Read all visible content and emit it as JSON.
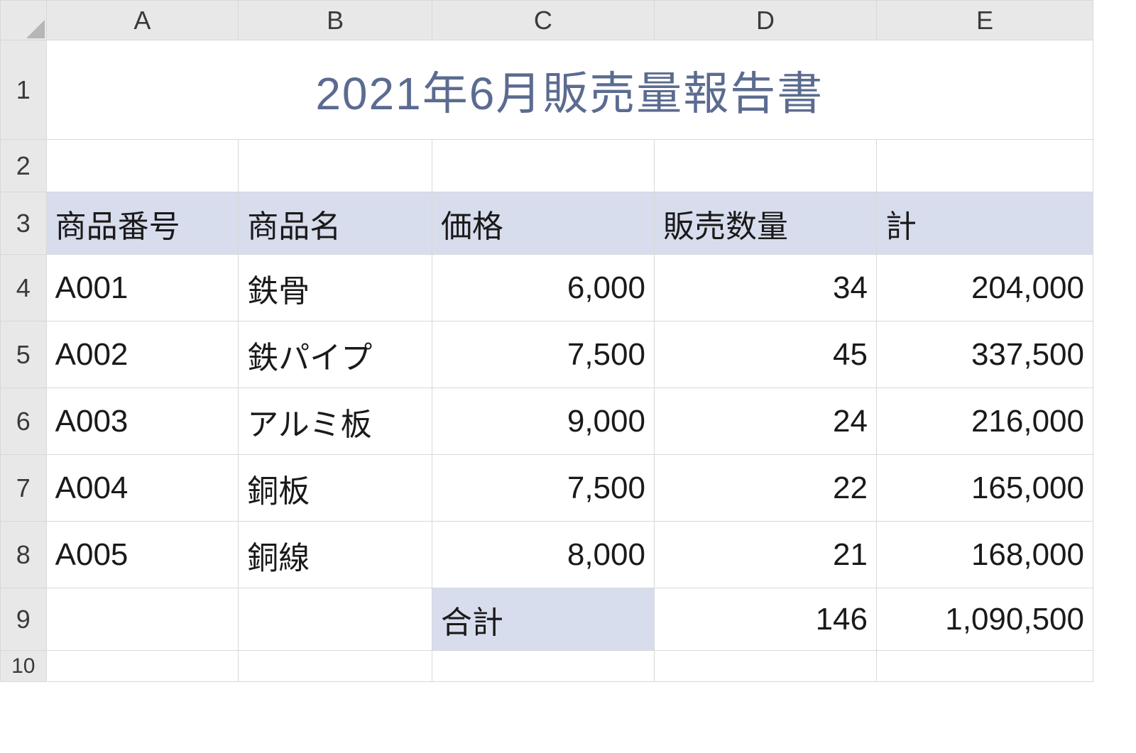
{
  "columns": [
    "A",
    "B",
    "C",
    "D",
    "E"
  ],
  "row_labels": [
    "1",
    "2",
    "3",
    "4",
    "5",
    "6",
    "7",
    "8",
    "9",
    "10"
  ],
  "title": "2021年6月販売量報告書",
  "headers": {
    "product_no": "商品番号",
    "product_name": "商品名",
    "price": "価格",
    "qty": "販売数量",
    "total": "計"
  },
  "rows": [
    {
      "no": "A001",
      "name": "鉄骨",
      "price": "6,000",
      "qty": "34",
      "total": "204,000"
    },
    {
      "no": "A002",
      "name": "鉄パイプ",
      "price": "7,500",
      "qty": "45",
      "total": "337,500"
    },
    {
      "no": "A003",
      "name": "アルミ板",
      "price": "9,000",
      "qty": "24",
      "total": "216,000"
    },
    {
      "no": "A004",
      "name": "銅板",
      "price": "7,500",
      "qty": "22",
      "total": "165,000"
    },
    {
      "no": "A005",
      "name": "銅線",
      "price": "8,000",
      "qty": "21",
      "total": "168,000"
    }
  ],
  "summary": {
    "label": "合計",
    "qty": "146",
    "total": "1,090,500"
  }
}
